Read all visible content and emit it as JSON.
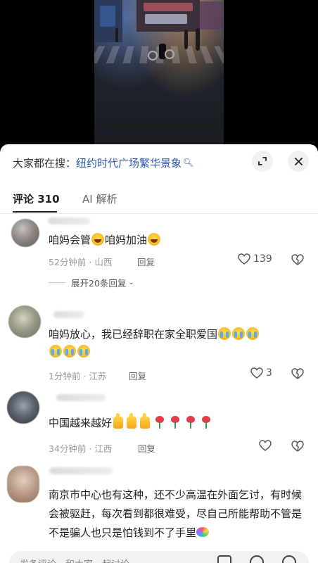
{
  "search": {
    "prefix": "大家都在搜：",
    "term": "纽约时代广场繁华景象",
    "icon": "search-icon"
  },
  "tabs": [
    {
      "label": "评论 310",
      "active": true
    },
    {
      "label": "AI 解析",
      "active": false
    }
  ],
  "comments": [
    {
      "text_before": "咱妈会管",
      "text_middle": "咱妈加油",
      "time": "52分钟前",
      "location": "山西",
      "reply_label": "回复",
      "likes": "139",
      "expand_label": "展开20条回复"
    },
    {
      "text_line1": "咱妈放心，我已经辞职在家全职爱国",
      "time": "1分钟前",
      "location": "江苏",
      "reply_label": "回复",
      "likes": "3"
    },
    {
      "text": "中国越来越好",
      "time": "34分钟前",
      "location": "江西",
      "reply_label": "回复",
      "likes": ""
    },
    {
      "text": "南京市中心也有这种，还不少高温在外面乞讨，有时候会被驱赶，每次看到都很难受，尽自己所能帮助不管是不是骗人也只是怕钱到不了手里"
    }
  ],
  "input": {
    "placeholder": "发条评论，和大家一起讨论"
  },
  "colors": {
    "search_term": "#2a57a8",
    "sheet_bg": "#ffffff",
    "video_bg": "#000000"
  }
}
